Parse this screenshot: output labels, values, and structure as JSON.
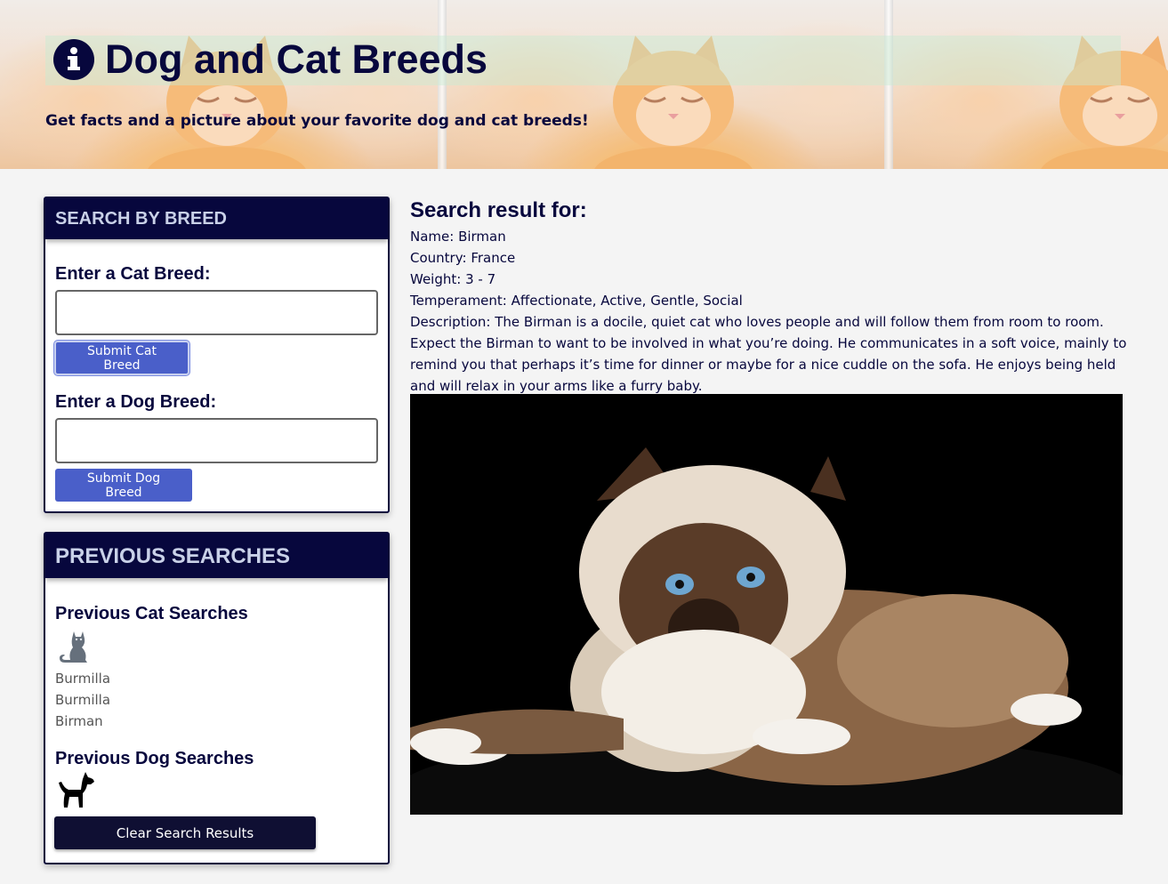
{
  "header": {
    "title": "Dog and Cat Breeds",
    "subtitle": "Get facts and a picture about your favorite dog and cat breeds!",
    "icon": "info-circle-icon"
  },
  "search_card": {
    "title": "SEARCH BY BREED",
    "cat_label": "Enter a Cat Breed:",
    "cat_input_value": "",
    "cat_button": "Submit Cat Breed",
    "dog_label": "Enter a Dog Breed:",
    "dog_input_value": "",
    "dog_button": "Submit Dog Breed"
  },
  "previous_card": {
    "title": "PREVIOUS SEARCHES",
    "cat_title": "Previous Cat Searches",
    "cat_icon": "cat-icon",
    "cat_searches": [
      "Burmilla",
      "Burmilla",
      "Birman"
    ],
    "dog_title": "Previous Dog Searches",
    "dog_icon": "dog-icon",
    "dog_searches": [],
    "clear_button": "Clear Search Results"
  },
  "result": {
    "heading": "Search result for:",
    "name": "Name: Birman",
    "country": "Country: France",
    "weight": "Weight: 3 - 7",
    "temperament": "Temperament: Affectionate, Active, Gentle, Social",
    "description": "Description: The Birman is a docile, quiet cat who loves people and will follow them from room to room. Expect the Birman to want to be involved in what you’re doing. He communicates in a soft voice, mainly to remind you that perhaps it’s time for dinner or maybe for a nice cuddle on the sofa. He enjoys being held and will relax in your arms like a furry baby."
  },
  "colors": {
    "navy": "#07073d",
    "button_blue": "#4a5fc9",
    "page_bg": "#f4f4f4"
  }
}
